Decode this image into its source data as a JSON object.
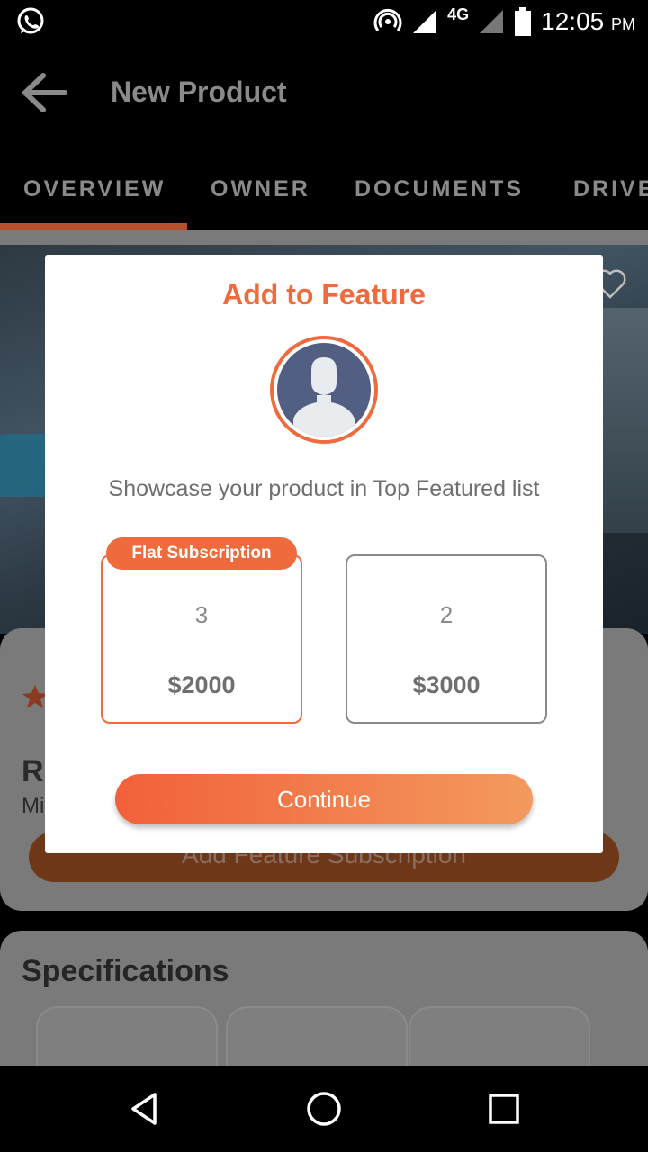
{
  "status_bar": {
    "network_label": "4G",
    "time": "12:05",
    "time_suffix": "PM"
  },
  "app_bar": {
    "title": "New Product"
  },
  "tabs": [
    {
      "label": "OVERVIEW",
      "selected": true
    },
    {
      "label": "OWNER",
      "selected": false
    },
    {
      "label": "DOCUMENTS",
      "selected": false
    },
    {
      "label": "DRIVE",
      "selected": false
    }
  ],
  "background": {
    "name_partial": "R",
    "subtitle_partial": "Mi",
    "add_feature_button": "Add Feature Subscription",
    "specifications_title": "Specifications"
  },
  "dialog": {
    "title": "Add to Feature",
    "description": "Showcase your product in Top Featured list",
    "plans": [
      {
        "badge": "Flat Subscription",
        "count": "3",
        "price": "$2000",
        "selected": true
      },
      {
        "count": "2",
        "price": "$3000",
        "selected": false
      }
    ],
    "continue_label": "Continue"
  },
  "colors": {
    "accent": "#ef6a3c",
    "accent_gradient_end": "#f39a5e",
    "avatar_bg": "#525e82"
  },
  "icons": {
    "status": [
      "whatsapp-icon",
      "hotspot-icon",
      "signal-icon",
      "battery-icon"
    ],
    "nav": [
      "back-triangle-icon",
      "home-circle-icon",
      "recents-square-icon"
    ]
  }
}
